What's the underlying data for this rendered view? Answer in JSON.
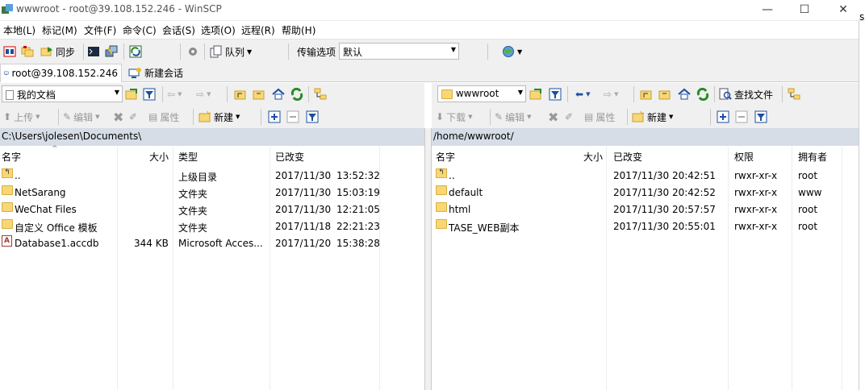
{
  "window": {
    "title": "wwwroot - root@39.108.152.246 - WinSCP",
    "minimize": "—",
    "maximize": "☐",
    "close": "✕"
  },
  "menu": [
    "本地(L)",
    "标记(M)",
    "文件(F)",
    "命令(C)",
    "会话(S)",
    "选项(O)",
    "远程(R)",
    "帮助(H)"
  ],
  "toolbar": {
    "sync_label": "同步",
    "queue_label": "队列",
    "transfer_options_label": "传输选项",
    "transfer_preset": "默认"
  },
  "tabs": {
    "session": "root@39.108.152.246",
    "new_session": "新建会话"
  },
  "left": {
    "location": "我的文档",
    "upload_label": "上传",
    "edit_label": "编辑",
    "properties_label": "属性",
    "new_label": "新建",
    "path": "C:\\Users\\jolesen\\Documents\\",
    "columns": {
      "name": "名字",
      "size": "大小",
      "type": "类型",
      "changed": "已改变"
    },
    "rows": [
      {
        "name": "..",
        "size": "",
        "type": "上级目录",
        "date": "2017/11/30",
        "time": "13:52:32",
        "icon": "updir"
      },
      {
        "name": "NetSarang",
        "size": "",
        "type": "文件夹",
        "date": "2017/11/30",
        "time": "15:03:19",
        "icon": "folder"
      },
      {
        "name": "WeChat Files",
        "size": "",
        "type": "文件夹",
        "date": "2017/11/30",
        "time": "12:21:05",
        "icon": "folder"
      },
      {
        "name": "自定义 Office 模板",
        "size": "",
        "type": "文件夹",
        "date": "2017/11/18",
        "time": "22:21:23",
        "icon": "folder"
      },
      {
        "name": "Database1.accdb",
        "size": "344 KB",
        "type": "Microsoft Acces...",
        "date": "2017/11/20",
        "time": "15:38:28",
        "icon": "accdb"
      }
    ]
  },
  "right": {
    "location": "wwwroot",
    "find_files_label": "查找文件",
    "download_label": "下载",
    "edit_label": "编辑",
    "properties_label": "属性",
    "new_label": "新建",
    "path": "/home/wwwroot/",
    "columns": {
      "name": "名字",
      "size": "大小",
      "changed": "已改变",
      "rights": "权限",
      "owner": "拥有者"
    },
    "rows": [
      {
        "name": "..",
        "changed": "2017/11/30 20:42:51",
        "rights": "rwxr-xr-x",
        "owner": "root",
        "icon": "updir"
      },
      {
        "name": "default",
        "changed": "2017/11/30 20:42:52",
        "rights": "rwxr-xr-x",
        "owner": "www",
        "icon": "folder"
      },
      {
        "name": "html",
        "changed": "2017/11/30 20:57:57",
        "rights": "rwxr-xr-x",
        "owner": "root",
        "icon": "folder"
      },
      {
        "name": "TASE_WEB副本",
        "changed": "2017/11/30 20:55:01",
        "rights": "rwxr-xr-x",
        "owner": "root",
        "icon": "folder"
      }
    ]
  },
  "right_edge_glyph": "s"
}
